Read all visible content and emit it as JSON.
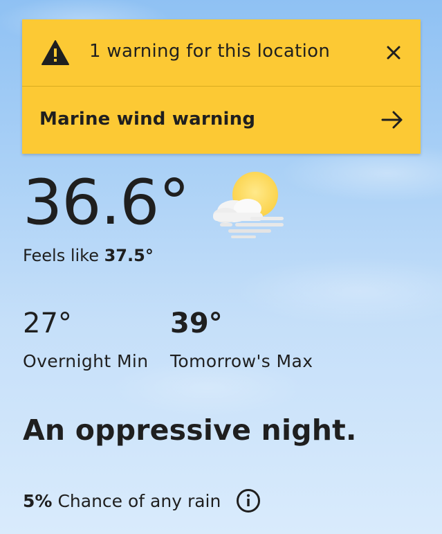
{
  "warnings": {
    "header_text": "1 warning for this location",
    "items": [
      {
        "label": "Marine wind warning"
      }
    ],
    "bg_color": "#fcc934"
  },
  "current": {
    "temperature": "36.6°",
    "feels_like_label": "Feels like",
    "feels_like_value": "37.5°",
    "condition_icon": "sun-behind-cloud-haze-icon"
  },
  "forecast": {
    "overnight_min_value": "27°",
    "overnight_min_label": "Overnight Min",
    "tomorrow_max_value": "39°",
    "tomorrow_max_label": "Tomorrow's Max"
  },
  "summary": "An oppressive night.",
  "rain": {
    "percent": "5%",
    "label": "Chance of any rain"
  },
  "icons": [
    "warning-triangle-icon",
    "close-icon",
    "arrow-right-icon",
    "info-icon"
  ]
}
